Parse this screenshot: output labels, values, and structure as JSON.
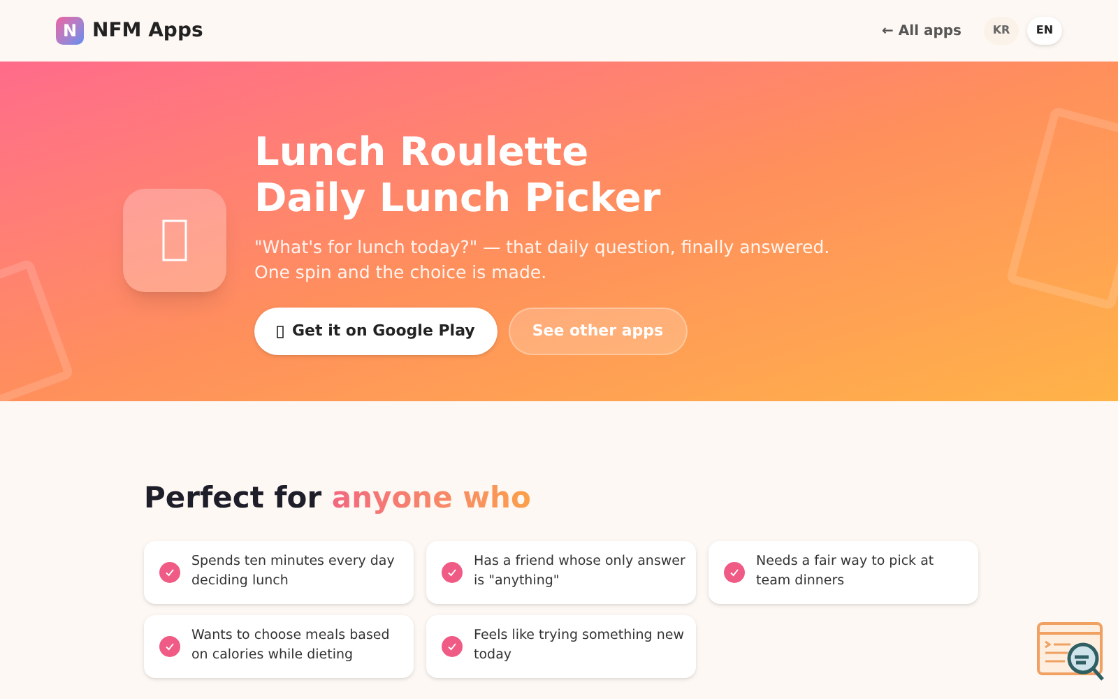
{
  "header": {
    "logo_letter": "N",
    "brand": "NFM Apps",
    "back_link": "← All apps",
    "languages": [
      {
        "label": "KR",
        "selected": false
      },
      {
        "label": "EN",
        "selected": true
      }
    ]
  },
  "hero": {
    "title_lines": [
      "Lunch Roulette",
      "Daily Lunch Picker"
    ],
    "subtitle_lines": [
      "\"What's for lunch today?\" — that daily question, finally answered.",
      "One spin and the choice is made."
    ],
    "primary_button": "Get it on Google Play",
    "secondary_button": "See other apps"
  },
  "audience": {
    "title": "Perfect for ",
    "title_highlight": "anyone who",
    "items": [
      {
        "text": "Spends ten minutes every day deciding lunch"
      },
      {
        "text": "Has a friend whose only answer is \"anything\""
      },
      {
        "text": "Needs a fair way to pick at team dinners"
      },
      {
        "text": "Wants to choose meals based on calories while dieting"
      },
      {
        "text": "Feels like trying something new today"
      }
    ]
  }
}
